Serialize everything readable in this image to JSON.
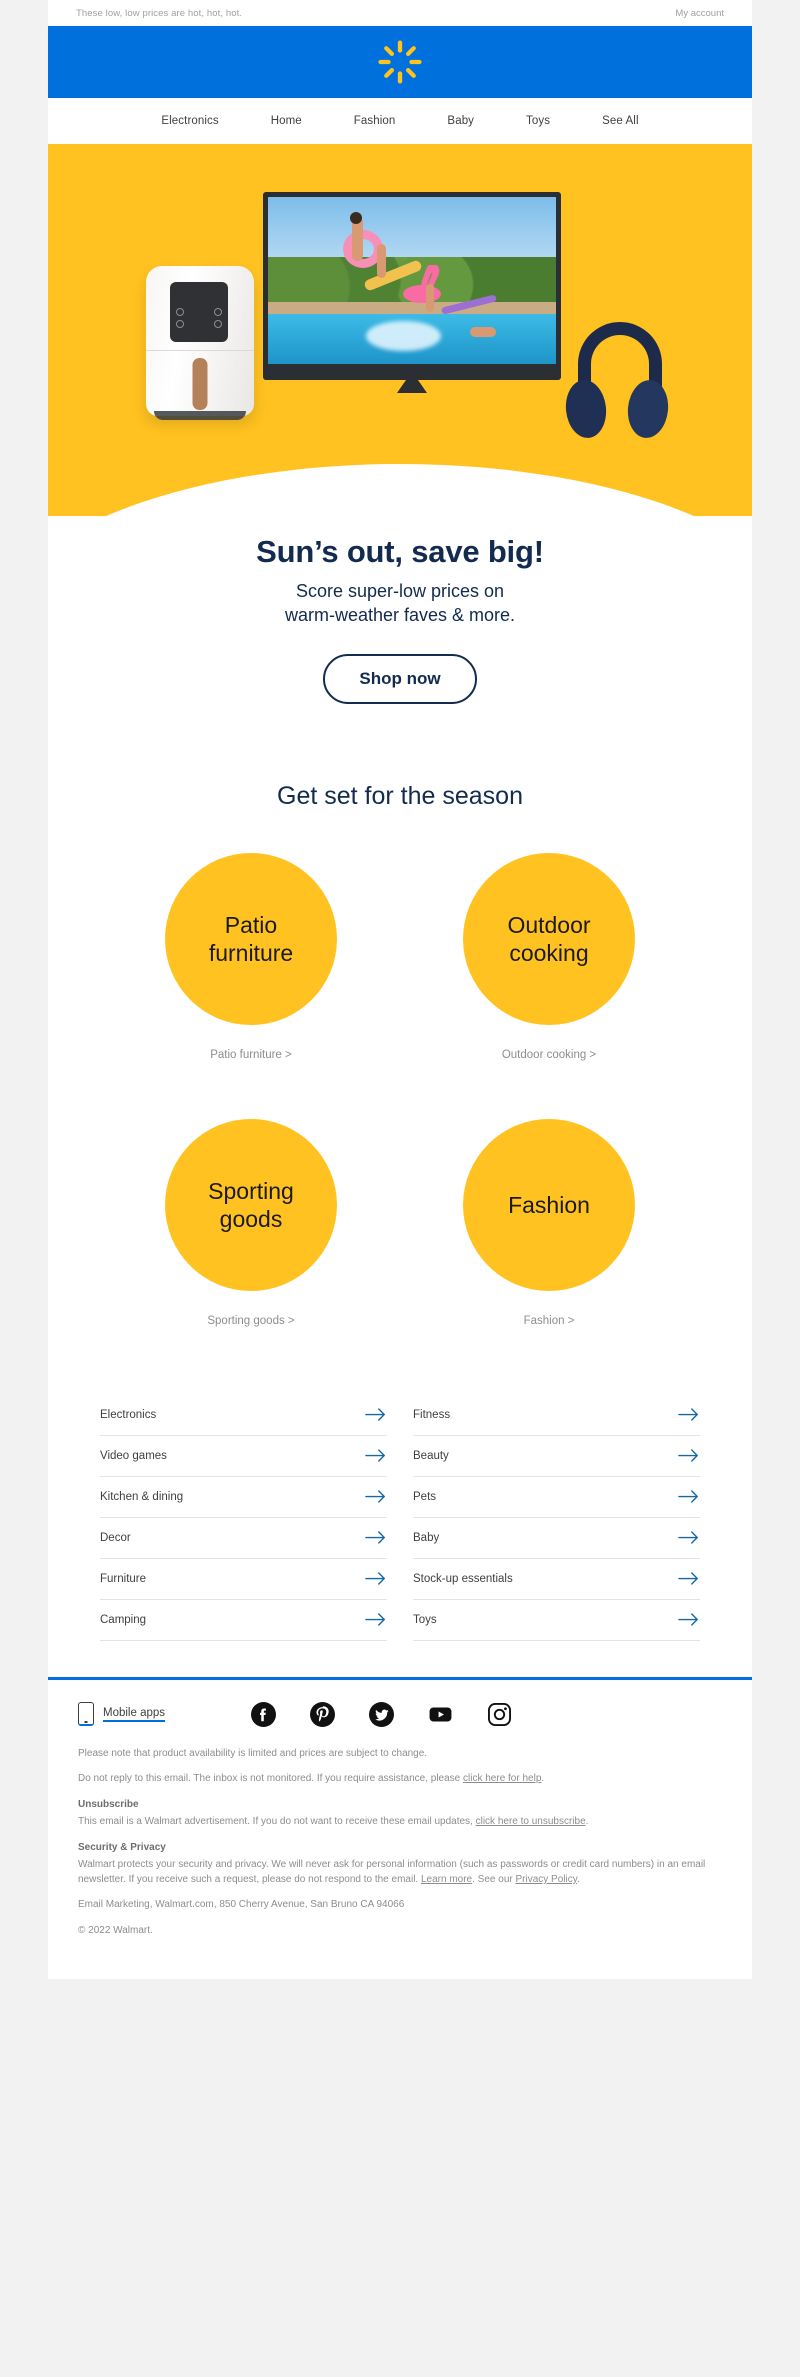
{
  "preheader": {
    "text": "These low, low prices are hot, hot, hot.",
    "account_link": "My account"
  },
  "brand": {
    "logo_name": "walmart-spark-logo",
    "blue": "#0071DC",
    "yellow": "#FFC220",
    "navy": "#122B4E"
  },
  "nav": {
    "items": [
      {
        "label": "Electronics"
      },
      {
        "label": "Home"
      },
      {
        "label": "Fashion"
      },
      {
        "label": "Baby"
      },
      {
        "label": "Toys"
      },
      {
        "label": "See All"
      }
    ]
  },
  "hero": {
    "products": [
      "air-fryer",
      "television",
      "headphones"
    ],
    "scene": "family jumping into pool shown on tv screen"
  },
  "promo": {
    "headline": "Sun’s out, save big!",
    "subhead_line1": "Score super-low prices on",
    "subhead_line2": "warm-weather faves & more.",
    "cta": "Shop now"
  },
  "categories": {
    "title": "Get set for the season",
    "items": [
      {
        "bubble_line1": "Patio",
        "bubble_line2": "furniture",
        "link": "Patio furniture >"
      },
      {
        "bubble_line1": "Outdoor",
        "bubble_line2": "cooking",
        "link": "Outdoor cooking >"
      },
      {
        "bubble_line1": "Sporting",
        "bubble_line2": "goods",
        "link": "Sporting goods >"
      },
      {
        "bubble_line1": "Fashion",
        "bubble_line2": "",
        "link": "Fashion >"
      }
    ]
  },
  "link_list": {
    "left": [
      {
        "label": "Electronics"
      },
      {
        "label": "Video games"
      },
      {
        "label": "Kitchen & dining"
      },
      {
        "label": "Decor"
      },
      {
        "label": "Furniture"
      },
      {
        "label": "Camping"
      }
    ],
    "right": [
      {
        "label": "Fitness"
      },
      {
        "label": "Beauty"
      },
      {
        "label": "Pets"
      },
      {
        "label": "Baby"
      },
      {
        "label": "Stock-up essentials"
      },
      {
        "label": "Toys"
      }
    ]
  },
  "footer": {
    "mobile_apps": "Mobile apps",
    "socials": [
      {
        "name": "facebook-icon"
      },
      {
        "name": "pinterest-icon"
      },
      {
        "name": "twitter-icon"
      },
      {
        "name": "youtube-icon"
      },
      {
        "name": "instagram-icon"
      }
    ],
    "availability_note": "Please note that product availability is limited and prices are subject to change.",
    "no_reply_pre": "Do not reply to this email. The inbox is not monitored. If you require assistance, please ",
    "no_reply_link": "click here for help",
    "no_reply_post": ".",
    "unsubscribe_title": "Unsubscribe",
    "unsubscribe_pre": "This email is a Walmart advertisement. If you do not want to receive these email updates, ",
    "unsubscribe_link": "click here to unsubscribe",
    "unsubscribe_post": ".",
    "security_title": "Security & Privacy",
    "security_body": "Walmart protects your security and privacy. We will never ask for personal information (such as passwords or credit card numbers) in an email newsletter. If you receive such a request, please do not respond to the email. ",
    "learn_more_link": "Learn more",
    "security_mid": ". See our ",
    "privacy_link": "Privacy Policy",
    "security_end": ".",
    "address": "Email Marketing, Walmart.com, 850 Cherry Avenue, San Bruno CA 94066",
    "copyright": "© 2022 Walmart."
  }
}
